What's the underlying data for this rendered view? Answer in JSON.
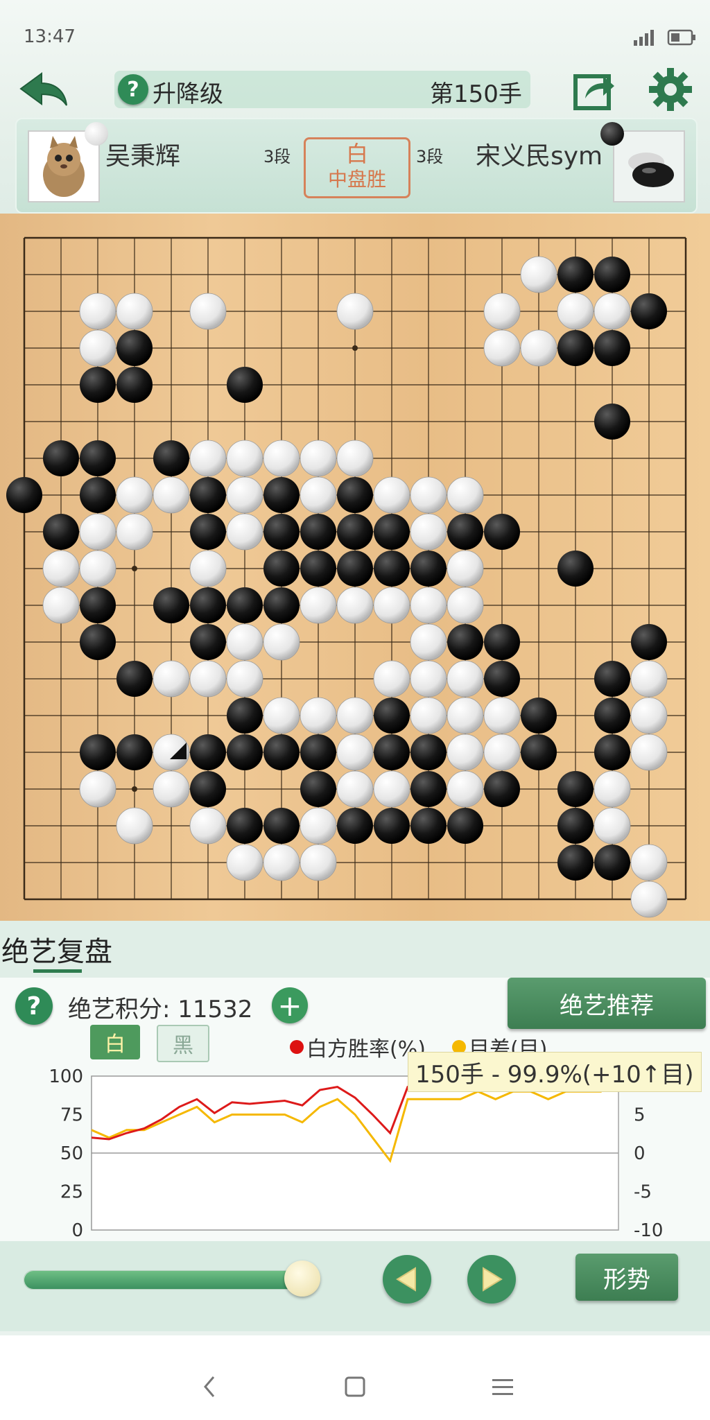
{
  "status_bar": {
    "time": "13:47"
  },
  "header": {
    "title": "升降级",
    "move_label": "第150手"
  },
  "players": {
    "white": {
      "name": "吴秉辉",
      "rank": "3段"
    },
    "black": {
      "name": "宋义民sym",
      "rank": "3段"
    },
    "result_color": "白",
    "result_text": "中盘胜"
  },
  "board": {
    "size": 19,
    "last_move": [
      4,
      14
    ],
    "white_stones": [
      [
        14,
        1
      ],
      [
        13,
        2
      ],
      [
        15,
        2
      ],
      [
        16,
        2
      ],
      [
        2,
        2
      ],
      [
        3,
        2
      ],
      [
        5,
        2
      ],
      [
        9,
        2
      ],
      [
        13,
        3
      ],
      [
        14,
        3
      ],
      [
        2,
        3
      ],
      [
        5,
        6
      ],
      [
        6,
        6
      ],
      [
        7,
        6
      ],
      [
        8,
        6
      ],
      [
        9,
        6
      ],
      [
        3,
        7
      ],
      [
        4,
        7
      ],
      [
        6,
        7
      ],
      [
        8,
        7
      ],
      [
        10,
        7
      ],
      [
        11,
        7
      ],
      [
        12,
        7
      ],
      [
        2,
        8
      ],
      [
        3,
        8
      ],
      [
        6,
        8
      ],
      [
        11,
        8
      ],
      [
        1,
        9
      ],
      [
        2,
        9
      ],
      [
        5,
        9
      ],
      [
        12,
        9
      ],
      [
        1,
        10
      ],
      [
        8,
        10
      ],
      [
        9,
        10
      ],
      [
        10,
        10
      ],
      [
        11,
        10
      ],
      [
        12,
        10
      ],
      [
        6,
        11
      ],
      [
        7,
        11
      ],
      [
        11,
        11
      ],
      [
        4,
        12
      ],
      [
        5,
        12
      ],
      [
        6,
        12
      ],
      [
        10,
        12
      ],
      [
        11,
        12
      ],
      [
        12,
        12
      ],
      [
        17,
        12
      ],
      [
        7,
        13
      ],
      [
        8,
        13
      ],
      [
        9,
        13
      ],
      [
        11,
        13
      ],
      [
        12,
        13
      ],
      [
        13,
        13
      ],
      [
        17,
        13
      ],
      [
        4,
        14
      ],
      [
        9,
        14
      ],
      [
        12,
        14
      ],
      [
        13,
        14
      ],
      [
        17,
        14
      ],
      [
        2,
        15
      ],
      [
        4,
        15
      ],
      [
        9,
        15
      ],
      [
        10,
        15
      ],
      [
        12,
        15
      ],
      [
        16,
        15
      ],
      [
        3,
        16
      ],
      [
        5,
        16
      ],
      [
        8,
        16
      ],
      [
        16,
        16
      ],
      [
        6,
        17
      ],
      [
        7,
        17
      ],
      [
        8,
        17
      ],
      [
        17,
        17
      ],
      [
        17,
        18
      ]
    ],
    "black_stones": [
      [
        15,
        1
      ],
      [
        16,
        1
      ],
      [
        17,
        2
      ],
      [
        3,
        3
      ],
      [
        15,
        3
      ],
      [
        16,
        3
      ],
      [
        2,
        4
      ],
      [
        3,
        4
      ],
      [
        6,
        4
      ],
      [
        16,
        5
      ],
      [
        1,
        6
      ],
      [
        2,
        6
      ],
      [
        4,
        6
      ],
      [
        0,
        7
      ],
      [
        2,
        7
      ],
      [
        5,
        7
      ],
      [
        7,
        7
      ],
      [
        9,
        7
      ],
      [
        1,
        8
      ],
      [
        5,
        8
      ],
      [
        7,
        8
      ],
      [
        8,
        8
      ],
      [
        9,
        8
      ],
      [
        10,
        8
      ],
      [
        12,
        8
      ],
      [
        13,
        8
      ],
      [
        7,
        9
      ],
      [
        8,
        9
      ],
      [
        9,
        9
      ],
      [
        10,
        9
      ],
      [
        11,
        9
      ],
      [
        15,
        9
      ],
      [
        2,
        10
      ],
      [
        4,
        10
      ],
      [
        5,
        10
      ],
      [
        6,
        10
      ],
      [
        7,
        10
      ],
      [
        2,
        11
      ],
      [
        5,
        11
      ],
      [
        12,
        11
      ],
      [
        13,
        11
      ],
      [
        17,
        11
      ],
      [
        3,
        12
      ],
      [
        13,
        12
      ],
      [
        16,
        12
      ],
      [
        6,
        13
      ],
      [
        10,
        13
      ],
      [
        14,
        13
      ],
      [
        16,
        13
      ],
      [
        2,
        14
      ],
      [
        3,
        14
      ],
      [
        5,
        14
      ],
      [
        6,
        14
      ],
      [
        7,
        14
      ],
      [
        8,
        14
      ],
      [
        10,
        14
      ],
      [
        11,
        14
      ],
      [
        14,
        14
      ],
      [
        16,
        14
      ],
      [
        5,
        15
      ],
      [
        8,
        15
      ],
      [
        11,
        15
      ],
      [
        13,
        15
      ],
      [
        15,
        15
      ],
      [
        6,
        16
      ],
      [
        7,
        16
      ],
      [
        9,
        16
      ],
      [
        10,
        16
      ],
      [
        11,
        16
      ],
      [
        12,
        16
      ],
      [
        15,
        16
      ],
      [
        15,
        17
      ],
      [
        16,
        17
      ]
    ]
  },
  "review": {
    "tab_label": "绝艺复盘",
    "score_label": "绝艺积分: 11532",
    "recommend_button": "绝艺推荐",
    "toggle_white": "白",
    "toggle_black": "黑",
    "legend_winrate": "白方胜率(%)",
    "legend_diff": "目差(目)",
    "tooltip": "150手 - 99.9%(+10↑目)",
    "shape_button": "形势",
    "progress": 1.0
  },
  "colors": {
    "winrate_line": "#dd1a1a",
    "diff_line": "#f5b800",
    "accent_green": "#3c9160",
    "result_orange": "#d6784d"
  },
  "chart_data": {
    "type": "line",
    "x": [
      0,
      5,
      10,
      15,
      20,
      25,
      30,
      35,
      40,
      45,
      50,
      55,
      60,
      65,
      70,
      75,
      80,
      85,
      90,
      95,
      100,
      105,
      110,
      115,
      120,
      125,
      130,
      135,
      140,
      145,
      150
    ],
    "series": [
      {
        "name": "白方胜率(%)",
        "values": [
          60,
          59,
          63,
          66,
          72,
          80,
          85,
          76,
          83,
          82,
          83,
          84,
          81,
          91,
          93,
          86,
          75,
          63,
          93,
          94,
          95,
          95,
          96,
          95,
          96,
          96,
          95,
          96,
          96,
          96,
          99.9
        ]
      },
      {
        "name": "目差(目)",
        "values": [
          3,
          2,
          3,
          3,
          4,
          5,
          6,
          4,
          5,
          5,
          5,
          5,
          4,
          6,
          7,
          5,
          2,
          -1,
          7,
          7,
          7,
          7,
          8,
          7,
          8,
          8,
          7,
          8,
          8,
          8,
          10
        ]
      }
    ],
    "ylim": [
      0,
      100
    ],
    "y2lim": [
      -10,
      10
    ],
    "y_ticks": [
      "100",
      "75",
      "50",
      "25",
      "0"
    ],
    "y2_ticks": [
      "5",
      "0",
      "-5",
      "-10"
    ],
    "grid": "midline at 50"
  }
}
